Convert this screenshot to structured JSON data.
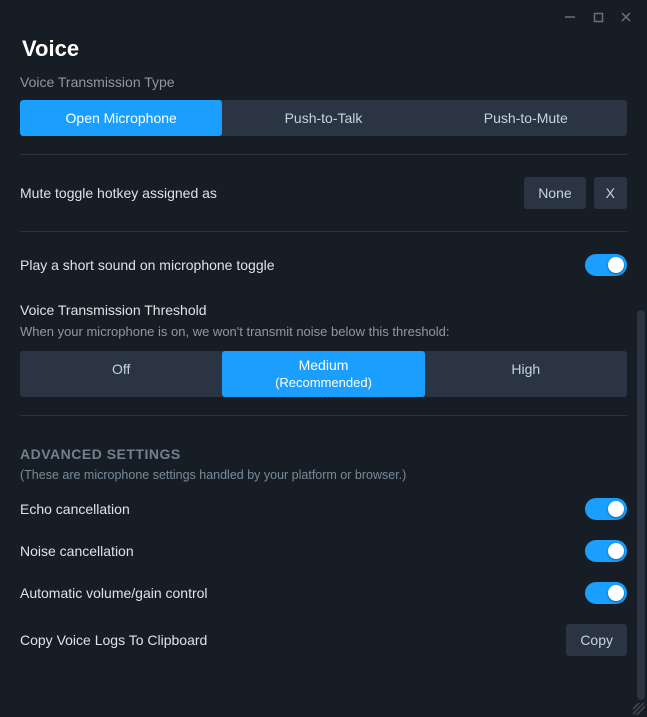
{
  "window": {
    "min": "−",
    "max": "▢",
    "close": "✕"
  },
  "title": "Voice",
  "transmission": {
    "label": "Voice Transmission Type",
    "options": [
      "Open Microphone",
      "Push-to-Talk",
      "Push-to-Mute"
    ],
    "selected": 0
  },
  "hotkey": {
    "label": "Mute toggle hotkey assigned as",
    "value": "None",
    "clear": "X"
  },
  "soundToggle": {
    "label": "Play a short sound on microphone toggle",
    "on": true
  },
  "threshold": {
    "title": "Voice Transmission Threshold",
    "desc": "When your microphone is on, we won't transmit noise below this threshold:",
    "options": [
      {
        "label": "Off"
      },
      {
        "label": "Medium",
        "sub": "(Recommended)"
      },
      {
        "label": "High"
      }
    ],
    "selected": 1
  },
  "advanced": {
    "title": "ADVANCED SETTINGS",
    "sub": "(These are microphone settings handled by your platform or browser.)",
    "items": [
      {
        "label": "Echo cancellation",
        "on": true
      },
      {
        "label": "Noise cancellation",
        "on": true
      },
      {
        "label": "Automatic volume/gain control",
        "on": true
      }
    ],
    "copy": {
      "label": "Copy Voice Logs To Clipboard",
      "button": "Copy"
    }
  }
}
